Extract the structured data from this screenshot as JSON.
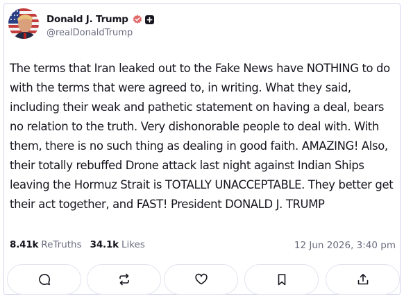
{
  "post": {
    "author": {
      "display_name": "Donald J. Trump",
      "handle": "@realDonaldTrump",
      "verified_color": "#e26a6a",
      "avatar_icon": "profile-photo-flag-background"
    },
    "text": "The terms that Iran leaked out to the Fake News have NOTHING to do with the terms that were agreed to, in writing. What they said, including their weak and pathetic statement on having a deal, bears no relation to the truth. Very dishonorable people to deal with. With them, there is no such thing as dealing in good faith. AMAZING! Also, their totally rebuffed Drone attack last night against Indian Ships leaving the Hormuz Strait is TOTALLY UNACCEPTABLE. They better get their act together, and FAST! President DONALD J. TRUMP",
    "stats": {
      "retruths_count": "8.41k",
      "retruths_label": "ReTruths",
      "likes_count": "34.1k",
      "likes_label": "Likes"
    },
    "timestamp": "12 Jun 2026, 3:40 pm",
    "actions": [
      {
        "name": "reply",
        "icon": "comment-icon"
      },
      {
        "name": "retruth",
        "icon": "repost-icon"
      },
      {
        "name": "like",
        "icon": "heart-icon"
      },
      {
        "name": "bookmark",
        "icon": "bookmark-icon"
      },
      {
        "name": "share",
        "icon": "share-icon"
      }
    ]
  },
  "colors": {
    "text": "#16141d",
    "muted": "#6b6d80",
    "border": "#d2d4ef",
    "button_border": "#e2e3ef"
  }
}
